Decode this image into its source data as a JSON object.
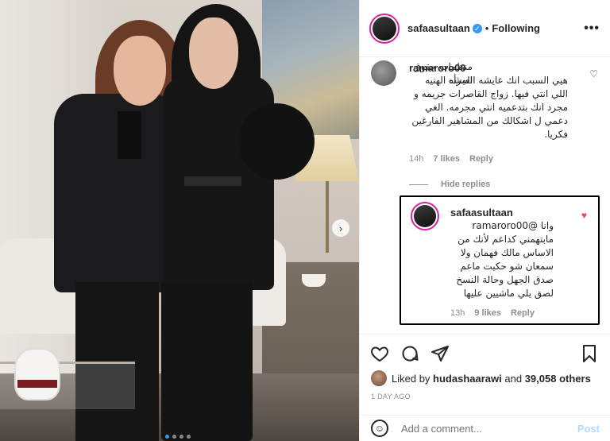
{
  "post": {
    "author": "safaasultaan",
    "verified_badge": "✓",
    "separator": "•",
    "follow_status": "Following",
    "more_icon": "more-options-icon",
    "more_glyph": "•••"
  },
  "photo": {
    "next_icon": "chevron-right-icon",
    "next_glyph": "›",
    "dots_count": 4,
    "active_dot": 0
  },
  "comments": [
    {
      "username": "ramaroro00",
      "first_line": "منظمات حقوق المرأه",
      "text": "هيي السبب انك عايشه العيشه الهنيه اللي انتي فيها. زواج القاصرات جريمه و مجرد انك بتدعميه انتي مجرمه. الغي دعمي ل اشكالك من المشاهير الفارغين فكريا.",
      "time": "14h",
      "likes": "7 likes",
      "reply_label": "Reply",
      "heart": "♡",
      "hide_replies": "Hide replies",
      "replies": [
        {
          "username": "safaasultaan",
          "text": "وانا @ramaroro00 مابتهمني كداعم لأنك من الاساس مالك فهمان ولا سمعان شو حكيت ماعم صدق الجهل وحالة النسخ لصق يلي ماشيين عليها",
          "time": "13h",
          "likes": "9 likes",
          "reply_label": "Reply",
          "heart": "♥"
        }
      ]
    }
  ],
  "actions": {
    "like_icon": "heart-icon",
    "comment_icon": "comment-icon",
    "share_icon": "share-icon",
    "save_icon": "bookmark-icon"
  },
  "likes_summary": {
    "prefix": "Liked by",
    "user": "hudashaarawi",
    "middle": "and",
    "count": "39,058 others"
  },
  "timestamp": "1 DAY AGO",
  "add_comment": {
    "smile_icon": "emoji-icon",
    "placeholder": "Add a comment...",
    "post_label": "Post"
  },
  "colors": {
    "verified": "#3897f0",
    "liked_heart": "#ed4956",
    "meta_gray": "#8e8e8e",
    "post_disabled": "#b3dbff"
  }
}
